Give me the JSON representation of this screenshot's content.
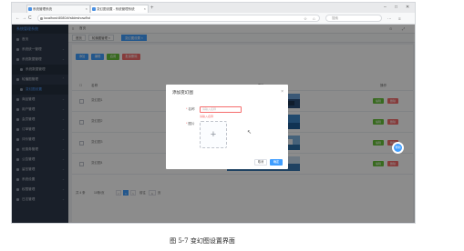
{
  "browser": {
    "tabs": [
      {
        "label": "系统管理系统"
      },
      {
        "label": "变幻图设置 - 系统管理系统"
      }
    ],
    "new_tab": "+",
    "url": "localhost:8080/#/slideshow/list",
    "search_placeholder": "搜索",
    "nav": {
      "back": "←",
      "forward": "→",
      "reload": "C",
      "home": "⌂"
    },
    "window": {
      "min": "–",
      "max": "□",
      "close": "✕"
    }
  },
  "sidebar": {
    "brand": "系统管理系统",
    "items": [
      {
        "label": "首页"
      },
      {
        "label": "系统统一管理"
      },
      {
        "label": "系统数据管理"
      },
      {
        "label": "系统数据管理"
      },
      {
        "label": "轮播图管理"
      },
      {
        "label": "变幻图设置"
      },
      {
        "label": "商品管理"
      },
      {
        "label": "用户管理"
      },
      {
        "label": "会员管理"
      },
      {
        "label": "订单管理"
      },
      {
        "label": "评价管理"
      },
      {
        "label": "优惠券管理"
      },
      {
        "label": "公告管理"
      },
      {
        "label": "留言管理"
      },
      {
        "label": "系统设置"
      },
      {
        "label": "权限管理"
      },
      {
        "label": "日志管理"
      }
    ]
  },
  "topbar": {
    "title": "首页",
    "menu_icon": "≡",
    "icons": [
      "⊙",
      "⤢"
    ]
  },
  "page_tabs": [
    {
      "label": "首页"
    },
    {
      "label": "轮播图管理 ×"
    },
    {
      "label": "变幻图设置 ×"
    }
  ],
  "toolbar": [
    {
      "label": "添加",
      "color": "#409eff"
    },
    {
      "label": "编辑",
      "color": "#409eff"
    },
    {
      "label": "启用",
      "color": "#67c23a"
    },
    {
      "label": "批量删除",
      "color": "#f56c6c"
    }
  ],
  "table": {
    "headers": [
      "名称",
      "图片",
      "操作"
    ],
    "rows": [
      {
        "name": "变幻图1",
        "edit": "编辑",
        "del": "删除"
      },
      {
        "name": "变幻图2",
        "edit": "编辑",
        "del": "删除"
      },
      {
        "name": "变幻图3",
        "edit": "编辑",
        "del": "删除"
      },
      {
        "name": "变幻图4",
        "edit": "编辑",
        "del": "删除"
      }
    ]
  },
  "pager": {
    "total": "共 4 条",
    "page_size": "10条/页",
    "prev": "<",
    "current": "1",
    "next": ">",
    "goto": "前往",
    "goto_page": "1",
    "page_unit": "页"
  },
  "dialog": {
    "title": "添加变幻图",
    "close": "×",
    "name_label": "名称",
    "name_placeholder": "请输入名称",
    "name_error": "请输入名称",
    "image_label": "图片",
    "upload_plus": "+",
    "cancel": "取消",
    "confirm": "确定"
  },
  "fab_label": "帮助",
  "caption": "图 5-7 变幻图设置界面"
}
